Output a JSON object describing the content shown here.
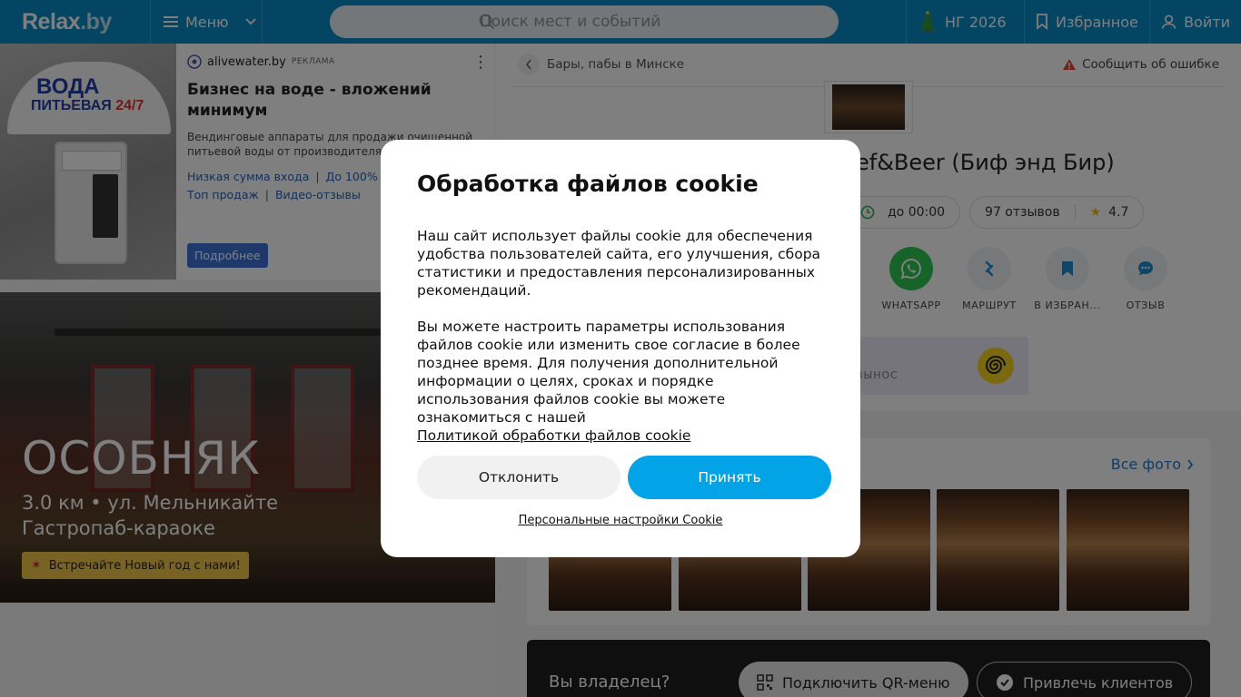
{
  "header": {
    "logo": "Relax",
    "logo_suffix": ".by",
    "menu_label": "Меню",
    "search_placeholder": "Поиск мест и событий",
    "newyear_label": "НГ 2026",
    "favorites_label": "Избранное",
    "login_label": "Войти"
  },
  "ad": {
    "source": "alivewater.by",
    "tag": "РЕКЛАМА",
    "image_line1": "ВОДА",
    "image_line2": "ПИТЬЕВАЯ",
    "image_line2_accent": "24/7",
    "title": "Бизнес на воде - вложений минимум",
    "text": "Вендинговые аппараты для продажи очищенной питьевой воды от производителя!",
    "links": [
      "Низкая сумма входа",
      "До 100% г",
      "Топ продаж",
      "Видео-отзывы"
    ],
    "button": "Подробнее"
  },
  "promo": {
    "title": "ОСОБНЯК",
    "address": "3.0 км • ул. Мельникайте",
    "subtitle": "Гастропаб-караоке",
    "chip": "Встречайте Новый год с нами!"
  },
  "place": {
    "breadcrumb": "Бары, пабы в Минске",
    "report": "Сообщить об ошибке",
    "title": "ef&Beer (Биф энд Бир)",
    "hours": "до 00:00",
    "reviews": "97 отзывов",
    "rating": "4.7",
    "actions": [
      "WHATSAPP",
      "МАРШРУТ",
      "В ИЗБРАН...",
      "ОТЗЫВ"
    ],
    "banner_text": "ВЫНОС",
    "all_photos": "Все фото",
    "owner_question": "Вы владелец?",
    "owner_qr": "Подключить QR-меню",
    "owner_clients": "Привлечь клиентов"
  },
  "cookie": {
    "title": "Обработка файлов cookie",
    "p1": "Наш сайт использует файлы cookie для обеспечения удобства пользователей сайта, его улучшения, сбора статистики и предоставления персонализированных рекомендаций.",
    "p2": "Вы можете настроить параметры использования файлов cookie или изменить свое согласие в более позднее время. Для получения дополнительной информации о целях, сроках и порядке использования файлов cookie вы можете ознакомиться с нашей",
    "policy_link": "Политикой обработки файлов cookie",
    "decline": "Отклонить",
    "accept": "Принять",
    "settings": "Персональные настройки Cookie"
  },
  "colors": {
    "header": "#0a8bc8",
    "accept": "#03a3e8",
    "whatsapp": "#2fc655",
    "link": "#1f7ac9"
  }
}
